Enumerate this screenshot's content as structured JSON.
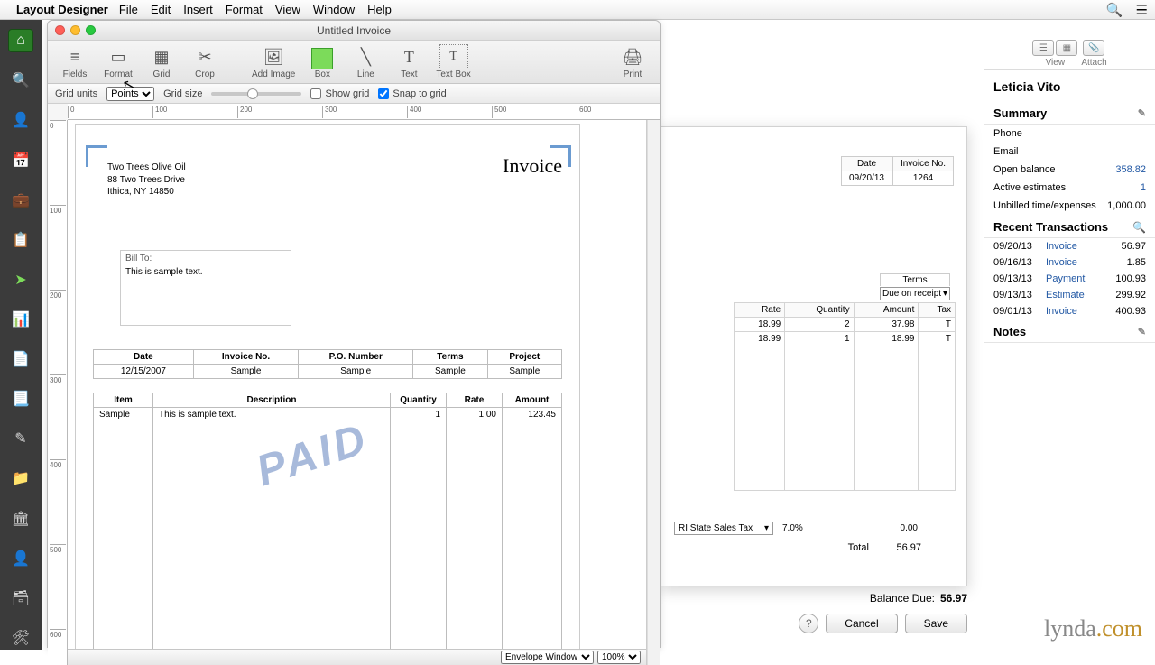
{
  "menubar": {
    "app": "Layout Designer",
    "items": [
      "File",
      "Edit",
      "Insert",
      "Format",
      "View",
      "Window",
      "Help"
    ]
  },
  "window": {
    "title": "Untitled Invoice"
  },
  "toolbar": {
    "fields": "Fields",
    "format": "Format",
    "grid": "Grid",
    "crop": "Crop",
    "addImage": "Add Image",
    "box": "Box",
    "line": "Line",
    "text": "Text",
    "textBox": "Text Box",
    "print": "Print"
  },
  "options": {
    "gridUnitsLabel": "Grid units",
    "gridUnitsValue": "Points",
    "gridSizeLabel": "Grid size",
    "showGrid": "Show grid",
    "snapToGrid": "Snap to grid"
  },
  "company": {
    "name": "Two Trees Olive Oil",
    "street": "88 Two Trees Drive",
    "city": "Ithica, NY 14850"
  },
  "invoiceTitle": "Invoice",
  "billTo": {
    "label": "Bill To:",
    "text": "This is sample text."
  },
  "metaHeaders": [
    "Date",
    "Invoice No.",
    "P.O. Number",
    "Terms",
    "Project"
  ],
  "metaValues": [
    "12/15/2007",
    "Sample",
    "Sample",
    "Sample",
    "Sample"
  ],
  "itemHeaders": [
    "Item",
    "Description",
    "Quantity",
    "Rate",
    "Amount"
  ],
  "itemRow": {
    "item": "Sample",
    "desc": "This is sample text.",
    "qty": "1",
    "rate": "1.00",
    "amount": "123.45"
  },
  "watermark": "PAID",
  "footer": {
    "envelope": "Envelope Window",
    "zoom": "100%"
  },
  "bgInvoice": {
    "dateLabel": "Date",
    "dateValue": "09/20/13",
    "numLabel": "Invoice No.",
    "numValue": "1264",
    "termsLabel": "Terms",
    "termsValue": "Due on receipt",
    "headers": [
      "Rate",
      "Quantity",
      "Amount",
      "Tax"
    ],
    "rows": [
      {
        "rate": "18.99",
        "qty": "2",
        "amount": "37.98",
        "tax": "T"
      },
      {
        "rate": "18.99",
        "qty": "1",
        "amount": "18.99",
        "tax": "T"
      }
    ],
    "taxName": "RI State Sales Tax",
    "taxPct": "7.0%",
    "taxAmt": "0.00",
    "totalLabel": "Total",
    "totalValue": "56.97"
  },
  "balance": {
    "label": "Balance Due:",
    "value": "56.97"
  },
  "actions": {
    "cancel": "Cancel",
    "save": "Save"
  },
  "rightPanel": {
    "view": "View",
    "attach": "Attach",
    "customer": "Leticia Vito",
    "summary": "Summary",
    "phone": "Phone",
    "email": "Email",
    "openBalLabel": "Open balance",
    "openBalValue": "358.82",
    "activeEstLabel": "Active estimates",
    "activeEstValue": "1",
    "unbilledLabel": "Unbilled time/expenses",
    "unbilledValue": "1,000.00",
    "recent": "Recent Transactions",
    "trans": [
      {
        "date": "09/20/13",
        "type": "Invoice",
        "amount": "56.97"
      },
      {
        "date": "09/16/13",
        "type": "Invoice",
        "amount": "1.85"
      },
      {
        "date": "09/13/13",
        "type": "Payment",
        "amount": "100.93"
      },
      {
        "date": "09/13/13",
        "type": "Estimate",
        "amount": "299.92"
      },
      {
        "date": "09/01/13",
        "type": "Invoice",
        "amount": "400.93"
      }
    ],
    "notes": "Notes"
  },
  "brand": {
    "main": "lynda",
    "dot": ".com"
  }
}
